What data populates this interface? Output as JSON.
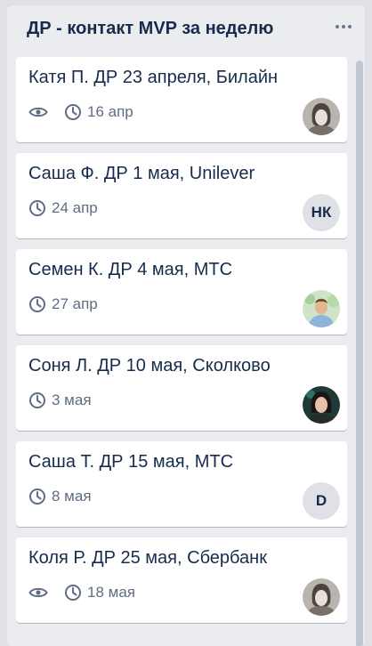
{
  "list": {
    "title": "ДР - контакт MVP за неделю",
    "menu_icon": "ellipsis-icon"
  },
  "cards": [
    {
      "title": "Катя П. ДР 23 апреля, Билайн",
      "watch_icon": "eye-icon",
      "due_icon": "clock-icon",
      "due": "16 апр",
      "avatar": "photo-woman-grey"
    },
    {
      "title": "Саша Ф. ДР 1 мая, Unilever",
      "due_icon": "clock-icon",
      "due": "24 апр",
      "avatar_initials": "НК"
    },
    {
      "title": "Семен К. ДР 4 мая, МТС",
      "due_icon": "clock-icon",
      "due": "27 апр",
      "avatar": "photo-man-outdoor"
    },
    {
      "title": "Соня Л. ДР 10 мая, Сколково",
      "due_icon": "clock-icon",
      "due": "3 мая",
      "avatar": "photo-woman-dark"
    },
    {
      "title": "Саша Т. ДР 15 мая, МТС",
      "due_icon": "clock-icon",
      "due": "8 мая",
      "avatar_initials": "D"
    },
    {
      "title": "Коля Р. ДР 25 мая, Сбербанк",
      "watch_icon": "eye-icon",
      "due_icon": "clock-icon",
      "due": "18 мая",
      "avatar": "photo-woman-grey"
    }
  ]
}
